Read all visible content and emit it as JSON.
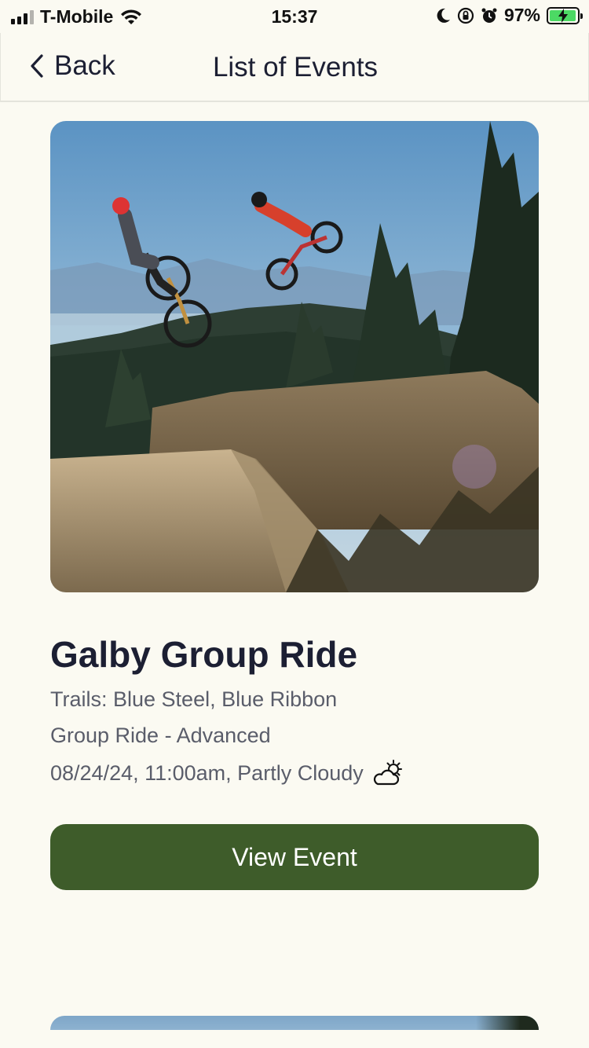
{
  "status_bar": {
    "carrier": "T-Mobile",
    "time": "15:37",
    "battery_percent": "97%",
    "battery_level": 0.97,
    "icons": [
      "signal-icon",
      "wifi-icon",
      "moon-icon",
      "orientation-lock-icon",
      "alarm-icon",
      "battery-charging-icon"
    ]
  },
  "nav": {
    "back_label": "Back",
    "title": "List of Events"
  },
  "event": {
    "title": "Galby Group Ride",
    "trails": "Trails: Blue Steel, Blue Ribbon",
    "type": "Group Ride - Advanced",
    "datetime_weather": "08/24/24, 11:00am, Partly Cloudy",
    "weather_icon": "partly-cloudy-icon",
    "button_label": "View Event"
  },
  "colors": {
    "background": "#fbfaf2",
    "primary_button": "#3e5c2a",
    "title_text": "#1c1f33",
    "detail_text": "#5a5d6a"
  }
}
